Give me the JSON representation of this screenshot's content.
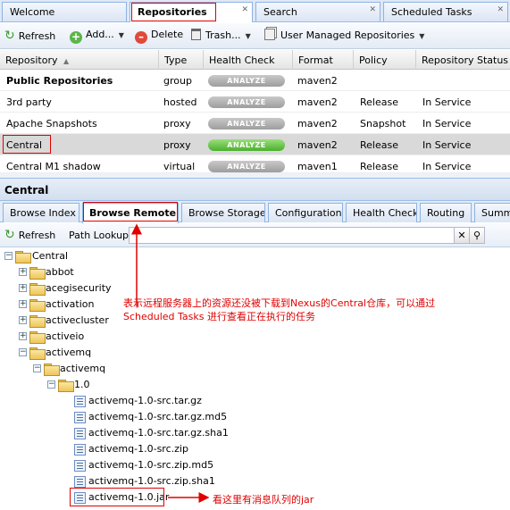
{
  "top_tabs": [
    {
      "label": "Welcome"
    },
    {
      "label": "Repositories"
    },
    {
      "label": "Search"
    },
    {
      "label": "Scheduled Tasks"
    }
  ],
  "toolbar": {
    "refresh": "Refresh",
    "add": "Add...",
    "delete": "Delete",
    "trash": "Trash...",
    "user_managed": "User Managed Repositories"
  },
  "grid": {
    "columns": [
      "Repository",
      "Type",
      "Health Check",
      "Format",
      "Policy",
      "Repository Status"
    ],
    "analyze_label": "ANALYZE",
    "rows": [
      {
        "name": "Public Repositories",
        "type": "group",
        "format": "maven2",
        "policy": "",
        "status": ""
      },
      {
        "name": "3rd party",
        "type": "hosted",
        "format": "maven2",
        "policy": "Release",
        "status": "In Service"
      },
      {
        "name": "Apache Snapshots",
        "type": "proxy",
        "format": "maven2",
        "policy": "Snapshot",
        "status": "In Service"
      },
      {
        "name": "Central",
        "type": "proxy",
        "format": "maven2",
        "policy": "Release",
        "status": "In Service"
      },
      {
        "name": "Central M1 shadow",
        "type": "virtual",
        "format": "maven1",
        "policy": "Release",
        "status": "In Service"
      }
    ]
  },
  "detail": {
    "title": "Central",
    "tabs": [
      "Browse Index",
      "Browse Remote",
      "Browse Storage",
      "Configuration",
      "Health Check",
      "Routing",
      "Summa"
    ],
    "refresh": "Refresh",
    "path_lookup_label": "Path Lookup:",
    "path_lookup_value": ""
  },
  "tree": {
    "root": "Central",
    "folders": [
      "abbot",
      "acegisecurity",
      "activation",
      "activecluster",
      "activeio",
      "activemq",
      "activemq",
      "1.0"
    ],
    "files": [
      "activemq-1.0-src.tar.gz",
      "activemq-1.0-src.tar.gz.md5",
      "activemq-1.0-src.tar.gz.sha1",
      "activemq-1.0-src.zip",
      "activemq-1.0-src.zip.md5",
      "activemq-1.0-src.zip.sha1",
      "activemq-1.0.jar"
    ]
  },
  "annotations": {
    "note1_line1": "表示远程服务器上的资源还没被下载到Nexus的Central仓库，可以通过",
    "note1_line2": "Scheduled Tasks 进行查看正在执行的任务",
    "note2": "看这里有消息队列的jar"
  },
  "colors": {
    "annotation_red": "#e00000",
    "tab_border": "#99bbe8",
    "analyze_green": "#4caf2f"
  }
}
